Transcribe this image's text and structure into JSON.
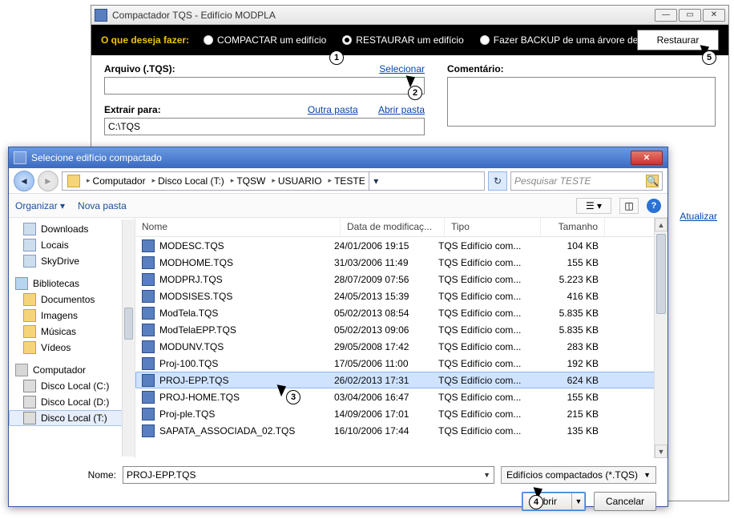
{
  "win1": {
    "title": "Compactador TQS - Edifício MODPLA",
    "question": "O que deseja fazer:",
    "radios": {
      "compactar": "COMPACTAR um edifício",
      "restaurar": "RESTAURAR um edifício",
      "backup": "Fazer BACKUP de uma árvore de edifícios"
    },
    "restore_btn": "Restaurar",
    "arquivo_label": "Arquivo (.TQS):",
    "selecionar": "Selecionar",
    "extrair_label": "Extrair para:",
    "extrair_value": "C:\\TQS",
    "outra_pasta": "Outra pasta",
    "abrir_pasta": "Abrir pasta",
    "comentario_label": "Comentário:",
    "atualizar": "Atualizar"
  },
  "dlg": {
    "title": "Selecione edifício compactado",
    "breadcrumb": [
      "Computador",
      "Disco Local (T:)",
      "TQSW",
      "USUARIO",
      "TESTE"
    ],
    "search_placeholder": "Pesquisar TESTE",
    "toolbar": {
      "organizar": "Organizar",
      "nova_pasta": "Nova pasta"
    },
    "sidebar": {
      "fav": [
        {
          "label": "Downloads"
        },
        {
          "label": "Locais"
        },
        {
          "label": "SkyDrive"
        }
      ],
      "bib_label": "Bibliotecas",
      "bib": [
        {
          "label": "Documentos"
        },
        {
          "label": "Imagens"
        },
        {
          "label": "Músicas"
        },
        {
          "label": "Vídeos"
        }
      ],
      "comp_label": "Computador",
      "drives": [
        {
          "label": "Disco Local (C:)"
        },
        {
          "label": "Disco Local (D:)"
        },
        {
          "label": "Disco Local (T:)",
          "sel": true
        }
      ]
    },
    "columns": {
      "nome": "Nome",
      "data": "Data de modificaç...",
      "tipo": "Tipo",
      "tam": "Tamanho"
    },
    "files": [
      {
        "n": "MODESC.TQS",
        "d": "24/01/2006 19:15",
        "t": "TQS Edifício com...",
        "s": "104 KB"
      },
      {
        "n": "MODHOME.TQS",
        "d": "31/03/2006 11:49",
        "t": "TQS Edifício com...",
        "s": "155 KB"
      },
      {
        "n": "MODPRJ.TQS",
        "d": "28/07/2009 07:56",
        "t": "TQS Edifício com...",
        "s": "5.223 KB"
      },
      {
        "n": "MODSISES.TQS",
        "d": "24/05/2013 15:39",
        "t": "TQS Edifício com...",
        "s": "416 KB"
      },
      {
        "n": "ModTela.TQS",
        "d": "05/02/2013 08:54",
        "t": "TQS Edifício com...",
        "s": "5.835 KB"
      },
      {
        "n": "ModTelaEPP.TQS",
        "d": "05/02/2013 09:06",
        "t": "TQS Edifício com...",
        "s": "5.835 KB"
      },
      {
        "n": "MODUNV.TQS",
        "d": "29/05/2008 17:42",
        "t": "TQS Edifício com...",
        "s": "283 KB"
      },
      {
        "n": "Proj-100.TQS",
        "d": "17/05/2006 11:00",
        "t": "TQS Edifício com...",
        "s": "192 KB"
      },
      {
        "n": "PROJ-EPP.TQS",
        "d": "26/02/2013 17:31",
        "t": "TQS Edifício com...",
        "s": "624 KB",
        "sel": true
      },
      {
        "n": "PROJ-HOME.TQS",
        "d": "03/04/2006 16:47",
        "t": "TQS Edifício com...",
        "s": "155 KB"
      },
      {
        "n": "Proj-ple.TQS",
        "d": "14/09/2006 17:01",
        "t": "TQS Edifício com...",
        "s": "215 KB"
      },
      {
        "n": "SAPATA_ASSOCIADA_02.TQS",
        "d": "16/10/2006 17:44",
        "t": "TQS Edifício com...",
        "s": "135 KB"
      }
    ],
    "footer": {
      "nome_label": "Nome:",
      "nome_value": "PROJ-EPP.TQS",
      "type_filter": "Edifícios compactados (*.TQS)",
      "abrir": "Abrir",
      "cancelar": "Cancelar"
    }
  },
  "callouts": {
    "c1": "1",
    "c2": "2",
    "c3": "3",
    "c4": "4",
    "c5": "5"
  }
}
